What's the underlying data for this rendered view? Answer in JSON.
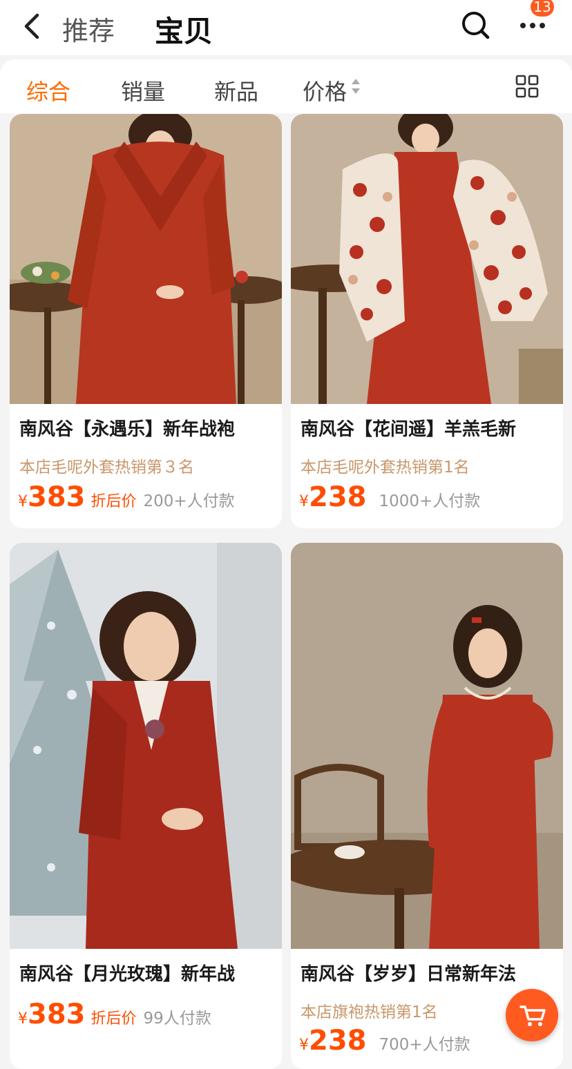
{
  "header": {
    "back_icon": "chevron-left-icon",
    "tab_recommend": "推荐",
    "tab_items": "宝贝",
    "more_badge": "13"
  },
  "sortbar": {
    "comprehensive": "综合",
    "sales": "销量",
    "new": "新品",
    "price": "价格"
  },
  "colors": {
    "accent": "#ff6a00",
    "price": "#ff4d00",
    "rank": "#c8976a"
  },
  "products": [
    {
      "title": "南风谷【永遇乐】新年战袍",
      "rank": "本店毛呢外套热销第３名",
      "currency": "¥",
      "price": "383",
      "discount": "折后价",
      "sold": "200+人付款"
    },
    {
      "title": "南风谷【花间遥】羊羔毛新",
      "rank": "本店毛呢外套热销第1名",
      "currency": "¥",
      "price": "238",
      "discount": "",
      "sold": "1000+人付款"
    },
    {
      "title": "南风谷【月光玫瑰】新年战",
      "rank": "",
      "currency": "¥",
      "price": "383",
      "discount": "折后价",
      "sold": "99人付款"
    },
    {
      "title": "南风谷【岁岁】日常新年法",
      "rank": "本店旗袍热销第1名",
      "currency": "¥",
      "price": "238",
      "discount": "",
      "sold": "700+人付款"
    }
  ]
}
